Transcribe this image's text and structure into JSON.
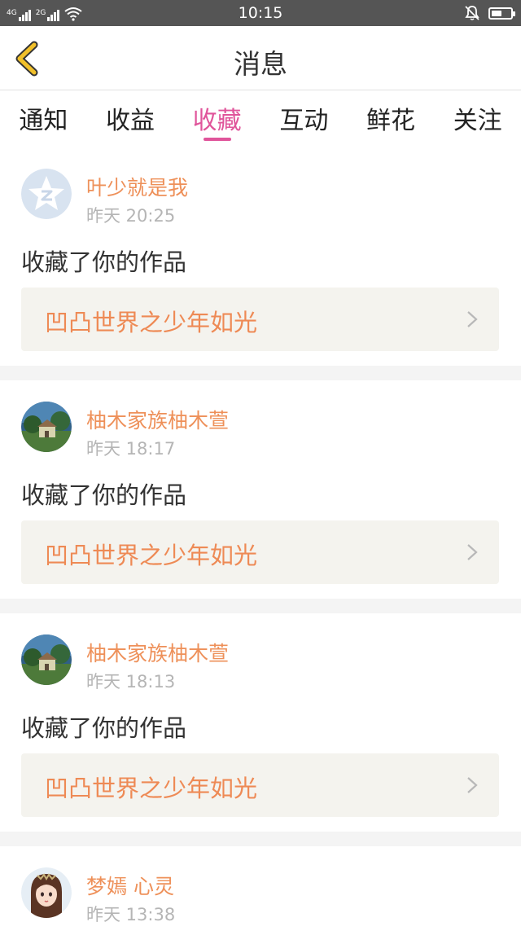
{
  "status_bar": {
    "time": "10:15",
    "network_1": "4G",
    "network_2": "2G",
    "battery_level": 0.55
  },
  "header": {
    "title": "消息"
  },
  "tabs": [
    {
      "label": "通知",
      "active": false
    },
    {
      "label": "收益",
      "active": false
    },
    {
      "label": "收藏",
      "active": true
    },
    {
      "label": "互动",
      "active": false
    },
    {
      "label": "鲜花",
      "active": false
    },
    {
      "label": "关注",
      "active": false
    }
  ],
  "messages": [
    {
      "user": "叶少就是我",
      "time": "昨天 20:25",
      "action": "收藏了你的作品",
      "work": "凹凸世界之少年如光",
      "avatar": "default-avatar-icon"
    },
    {
      "user": "柚木家族柚木萱",
      "time": "昨天 18:17",
      "action": "收藏了你的作品",
      "work": "凹凸世界之少年如光",
      "avatar": "landscape-avatar"
    },
    {
      "user": "柚木家族柚木萱",
      "time": "昨天 18:13",
      "action": "收藏了你的作品",
      "work": "凹凸世界之少年如光",
      "avatar": "landscape-avatar"
    },
    {
      "user": "梦嫣 心灵",
      "time": "昨天 13:38",
      "avatar": "anime-girl-avatar"
    }
  ],
  "colors": {
    "accent": "#e0559b",
    "username": "#ee9059",
    "work_title": "#ee8a55",
    "back_arrow": "#f1c02a"
  }
}
